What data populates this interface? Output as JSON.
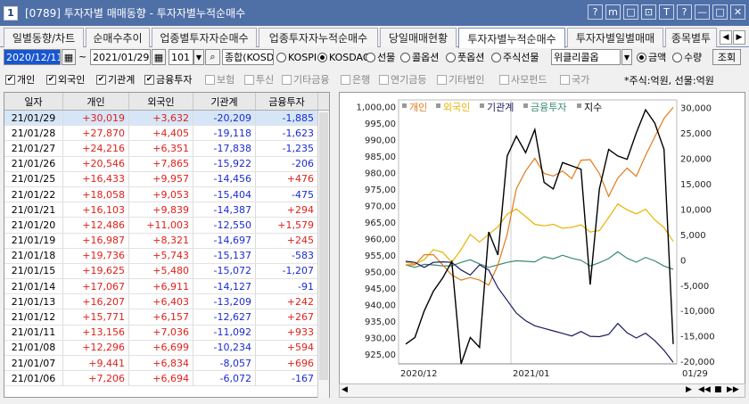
{
  "window": {
    "num": "1",
    "title": "[0789] 투자자별 매매동향 - 투자자별누적순매수"
  },
  "title_icons": [
    "?",
    "m",
    "□",
    "⊡",
    "T",
    "?",
    "—",
    "□",
    "✕"
  ],
  "tabs": [
    "일별동향/차트",
    "순매수추이",
    "업종별투자자순매수",
    "업종투자자누적순매수",
    "당일매매현황",
    "투자자별누적순매수",
    "투자자별일별매매",
    "종목별투"
  ],
  "active_tab": 5,
  "controls": {
    "start_date": "2020/12/11",
    "tilde": "~",
    "end_date": "2021/01/29",
    "count": "101",
    "market": "종합(KOSD",
    "btn_query": "조회"
  },
  "radios": [
    {
      "label": "KOSPI",
      "on": false
    },
    {
      "label": "KOSDAQ",
      "on": true
    },
    {
      "label": "선물",
      "on": false
    },
    {
      "label": "콜옵션",
      "on": false
    },
    {
      "label": "풋옵션",
      "on": false
    },
    {
      "label": "주식선물",
      "on": false
    }
  ],
  "weekly_select": "위클리콜옵",
  "unit_radios": [
    {
      "label": "금액",
      "on": true
    },
    {
      "label": "수량",
      "on": false
    }
  ],
  "checks": [
    {
      "label": "개인",
      "on": true
    },
    {
      "label": "외국인",
      "on": true
    },
    {
      "label": "기관계",
      "on": true
    },
    {
      "label": "금융투자",
      "on": true
    },
    {
      "label": "보험",
      "on": false,
      "dis": true
    },
    {
      "label": "투신",
      "on": false,
      "dis": true
    },
    {
      "label": "기타금융",
      "on": false,
      "dis": true
    },
    {
      "label": "은행",
      "on": false,
      "dis": true
    },
    {
      "label": "연기금등",
      "on": false,
      "dis": true
    },
    {
      "label": "기타법인",
      "on": false,
      "dis": true
    },
    {
      "label": "사모펀드",
      "on": false,
      "dis": true
    },
    {
      "label": "국가",
      "on": false,
      "dis": true
    }
  ],
  "unit_note": "*주식:억원, 선물:억원",
  "table": {
    "headers": [
      "일자",
      "개인",
      "외국인",
      "기관계",
      "금융투자"
    ],
    "rows": [
      [
        "21/01/29",
        "+30,019",
        "+3,632",
        "-20,209",
        "-1,885"
      ],
      [
        "21/01/28",
        "+27,870",
        "+4,405",
        "-19,118",
        "-1,623"
      ],
      [
        "21/01/27",
        "+24,216",
        "+6,351",
        "-17,838",
        "-1,235"
      ],
      [
        "21/01/26",
        "+20,546",
        "+7,865",
        "-15,922",
        "-206"
      ],
      [
        "21/01/25",
        "+16,433",
        "+9,957",
        "-14,456",
        "+476"
      ],
      [
        "21/01/22",
        "+18,058",
        "+9,053",
        "-15,404",
        "-475"
      ],
      [
        "21/01/21",
        "+16,103",
        "+9,839",
        "-14,387",
        "+294"
      ],
      [
        "21/01/20",
        "+12,486",
        "+11,003",
        "-12,550",
        "+1,579"
      ],
      [
        "21/01/19",
        "+16,987",
        "+8,321",
        "-14,697",
        "+245"
      ],
      [
        "21/01/18",
        "+19,736",
        "+5,743",
        "-15,137",
        "-583"
      ],
      [
        "21/01/15",
        "+19,625",
        "+5,480",
        "-15,072",
        "-1,207"
      ],
      [
        "21/01/14",
        "+17,067",
        "+6,911",
        "-14,127",
        "-91"
      ],
      [
        "21/01/13",
        "+16,207",
        "+6,403",
        "-13,209",
        "+242"
      ],
      [
        "21/01/12",
        "+15,771",
        "+6,157",
        "-12,627",
        "+267"
      ],
      [
        "21/01/11",
        "+13,156",
        "+7,036",
        "-11,092",
        "+933"
      ],
      [
        "21/01/08",
        "+12,296",
        "+6,699",
        "-10,234",
        "+594"
      ],
      [
        "21/01/07",
        "+9,441",
        "+6,834",
        "-8,057",
        "+696"
      ],
      [
        "21/01/06",
        "+7,206",
        "+6,694",
        "-6,072",
        "-167"
      ]
    ]
  },
  "chart_data": {
    "type": "line",
    "legend": [
      "개인",
      "외국인",
      "기관계",
      "금융투자",
      "지수"
    ],
    "colors": {
      "개인": "#e07b1a",
      "외국인": "#e8b400",
      "기관계": "#1a1a5e",
      "금융투자": "#3a8a6a",
      "지수": "#000000"
    },
    "left_ticks": [
      "1,000,00",
      "995,00",
      "990,00",
      "985,00",
      "980,00",
      "975,00",
      "970,00",
      "965,00",
      "960,00",
      "955,00",
      "950,00",
      "945,00",
      "940,00",
      "935,00",
      "930,00",
      "925,00"
    ],
    "right_ticks": [
      "30,000",
      "25,000",
      "20,000",
      "15,000",
      "10,000",
      "5,000",
      "0",
      "-5,000",
      "-10,000",
      "-15,000",
      "-20,000"
    ],
    "x_labels": [
      "2020/12",
      "2021/01",
      "01/29"
    ],
    "ylim_left": [
      922,
      1002
    ],
    "ylim_right": [
      -20500,
      31500
    ],
    "index": [
      928,
      930,
      938,
      944,
      948,
      953,
      922,
      930,
      927,
      962,
      955,
      985,
      991,
      986,
      993,
      977,
      975,
      983,
      982,
      981,
      946,
      975,
      987,
      985,
      984,
      992,
      999,
      995,
      987,
      928
    ],
    "individual": [
      -1000,
      -1000,
      1000,
      1000,
      -1000,
      -3000,
      -4000,
      -3500,
      -4000,
      -5000,
      -1000,
      5000,
      14000,
      17500,
      20000,
      17000,
      16500,
      17500,
      16000,
      19625,
      19736,
      16987,
      12486,
      16103,
      18058,
      16433,
      20546,
      24216,
      27870,
      30019
    ],
    "foreign": [
      -500,
      -800,
      0,
      2000,
      1500,
      -500,
      2000,
      5000,
      3500,
      5000,
      6500,
      9000,
      10000,
      8500,
      7000,
      6700,
      7000,
      6200,
      6400,
      6900,
      5480,
      5743,
      8321,
      11003,
      9839,
      9053,
      9957,
      7865,
      6351,
      3632
    ],
    "institution": [
      -300,
      -500,
      -1500,
      -500,
      -400,
      -500,
      -2000,
      -3000,
      -1000,
      -2000,
      -5500,
      -8000,
      -10500,
      -12000,
      -13000,
      -13500,
      -14000,
      -14500,
      -15000,
      -14127,
      -15072,
      -15137,
      -14697,
      -12550,
      -14387,
      -15404,
      -14456,
      -15922,
      -17838,
      -20209
    ],
    "fininv": [
      -1000,
      -1500,
      -900,
      -1000,
      -1200,
      -1200,
      -500,
      0,
      -800,
      -1500,
      -1000,
      -500,
      -200,
      -300,
      -400,
      600,
      200,
      900,
      300,
      -91,
      -1207,
      -583,
      245,
      1579,
      294,
      -475,
      476,
      -206,
      -1235,
      -1885
    ]
  }
}
